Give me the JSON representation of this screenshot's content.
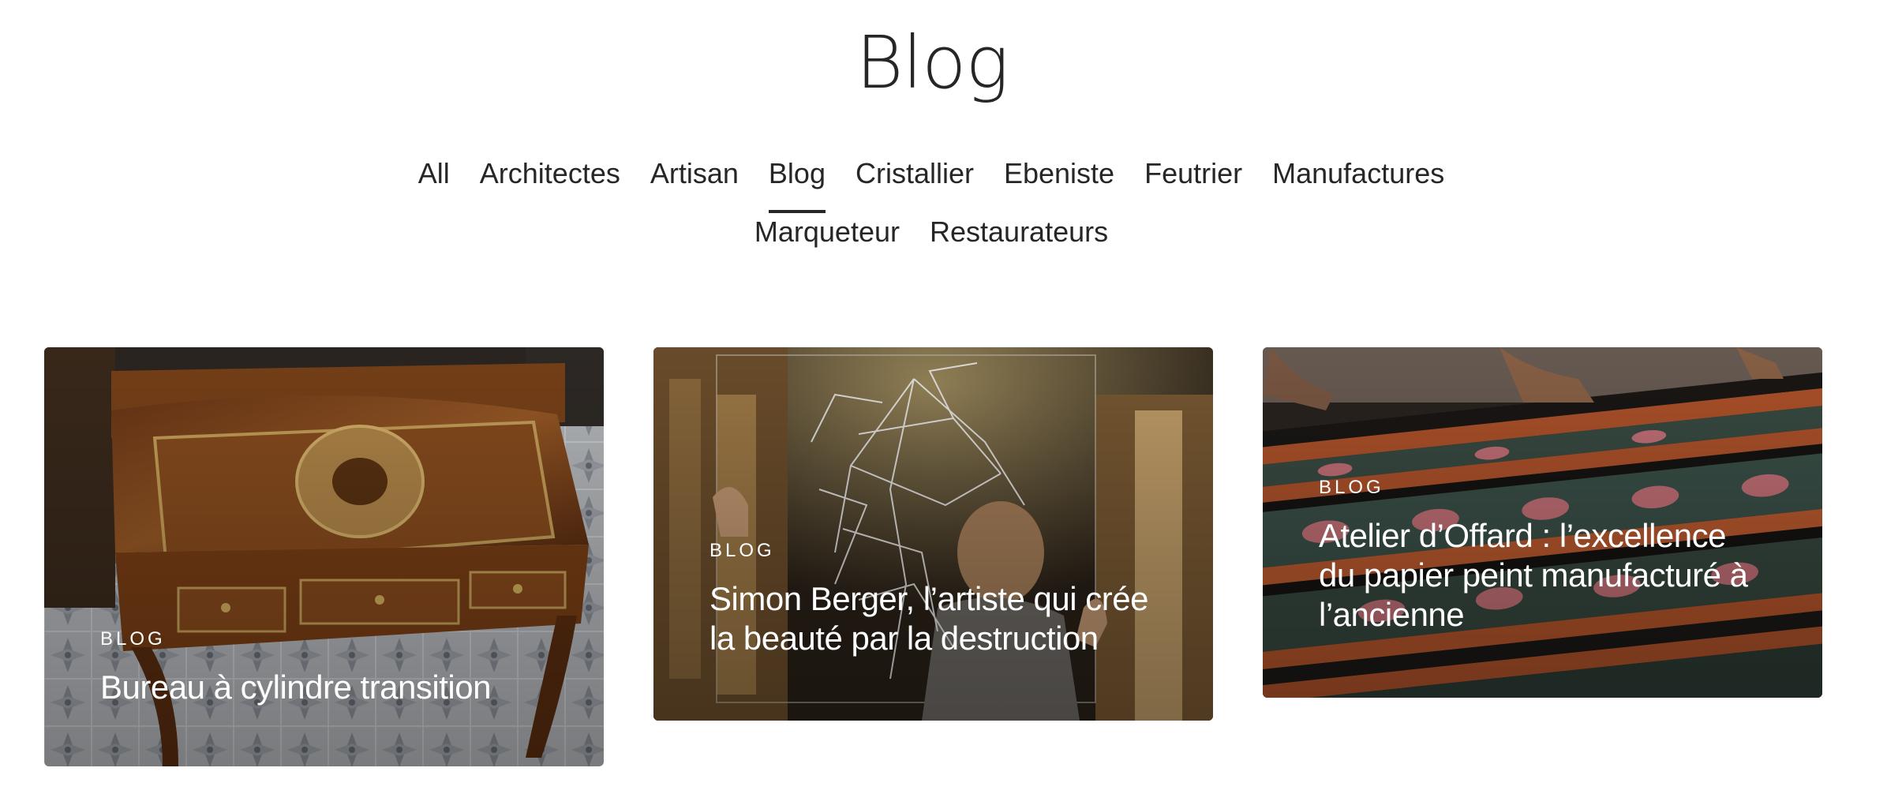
{
  "page": {
    "title": "Blog"
  },
  "filters": {
    "row1": [
      {
        "label": "All",
        "active": false
      },
      {
        "label": "Architectes",
        "active": false
      },
      {
        "label": "Artisan",
        "active": false
      },
      {
        "label": "Blog",
        "active": true
      },
      {
        "label": "Cristallier",
        "active": false
      },
      {
        "label": "Ebeniste",
        "active": false
      },
      {
        "label": "Feutrier",
        "active": false
      },
      {
        "label": "Manufactures",
        "active": false
      }
    ],
    "row2": [
      {
        "label": "Marqueteur",
        "active": false
      },
      {
        "label": "Restaurateurs",
        "active": false
      }
    ]
  },
  "posts": [
    {
      "category": "BLOG",
      "title": "Bureau à cylindre transition",
      "image_icon": "roll-top-desk-photo"
    },
    {
      "category": "BLOG",
      "title": "Simon Berger, l’artiste qui crée la beauté par la destruction",
      "image_icon": "shattered-glass-artist-photo"
    },
    {
      "category": "BLOG",
      "title": "Atelier d’Offard : l’excellence du papier peint manufacturé à l’ancienne",
      "image_icon": "striped-wallpaper-print-photo"
    }
  ],
  "colors": {
    "text": "#262626",
    "card_text": "#ffffff"
  }
}
